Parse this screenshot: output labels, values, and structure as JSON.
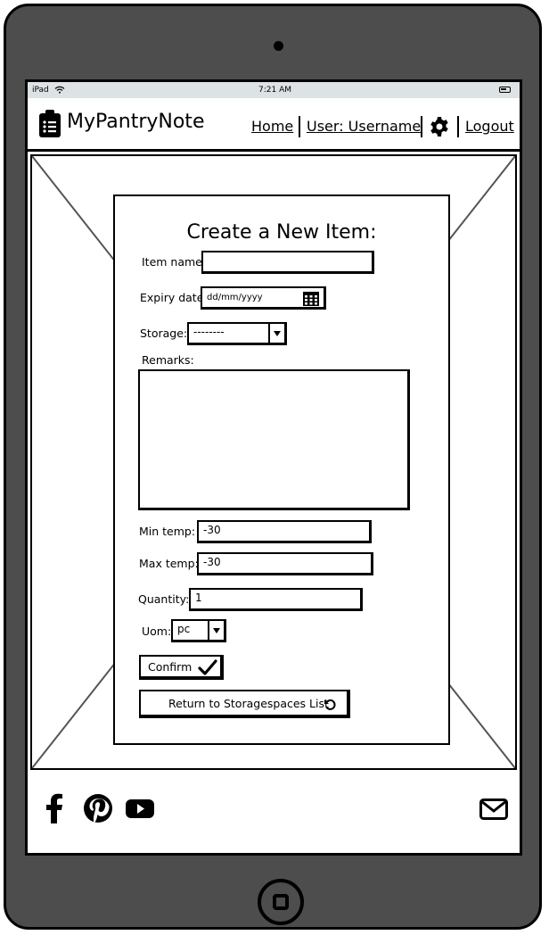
{
  "status": {
    "device": "iPad",
    "time": "7:21 AM"
  },
  "nav": {
    "brand": "MyPantryNote",
    "home": "Home",
    "user": "User: Username",
    "logout": "Logout"
  },
  "form": {
    "title": "Create a New Item:",
    "item_name_label": "Item name:",
    "item_name_value": "",
    "expiry_label": "Expiry date:",
    "expiry_placeholder": "dd/mm/yyyy",
    "storage_label": "Storage:",
    "storage_value": "--------",
    "remarks_label": "Remarks:",
    "remarks_value": "",
    "min_temp_label": "Min temp:",
    "min_temp_value": "-30",
    "max_temp_label": "Max temp:",
    "max_temp_value": "-30",
    "quantity_label": "Quantity:",
    "quantity_value": "1",
    "uom_label": "Uom:",
    "uom_value": "pc",
    "confirm_label": "Confirm",
    "return_label": "Return to Storagespaces List"
  },
  "footer": {
    "icons": [
      "facebook-icon",
      "pinterest-icon",
      "youtube-icon",
      "mail-icon"
    ]
  }
}
